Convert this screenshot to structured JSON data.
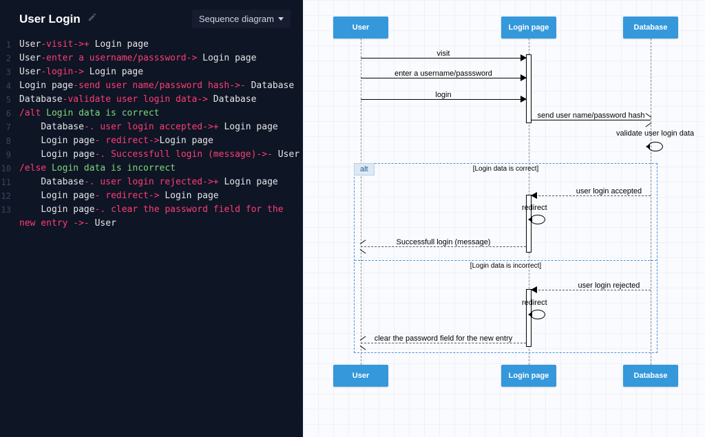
{
  "header": {
    "title": "User Login",
    "diagram_type_label": "Sequence diagram"
  },
  "code": {
    "lines": [
      {
        "n": 1,
        "tokens": [
          [
            "plain",
            "User"
          ],
          [
            "red",
            "-"
          ],
          [
            "red",
            "visit"
          ],
          [
            "red",
            "->+ "
          ],
          [
            "plain",
            "Login page"
          ]
        ]
      },
      {
        "n": 2,
        "tokens": [
          [
            "plain",
            "User"
          ],
          [
            "red",
            "-"
          ],
          [
            "red",
            "enter a username/passsword"
          ],
          [
            "red",
            "-> "
          ],
          [
            "plain",
            "Login page"
          ]
        ]
      },
      {
        "n": 3,
        "tokens": [
          [
            "plain",
            "User"
          ],
          [
            "red",
            "-"
          ],
          [
            "red",
            "login"
          ],
          [
            "red",
            "-> "
          ],
          [
            "plain",
            "Login page"
          ]
        ]
      },
      {
        "n": 4,
        "tokens": [
          [
            "plain",
            "Login page"
          ],
          [
            "red",
            "-"
          ],
          [
            "red",
            "send user name/password hash"
          ],
          [
            "red",
            "->- "
          ],
          [
            "plain",
            "Database"
          ]
        ]
      },
      {
        "n": 5,
        "tokens": [
          [
            "plain",
            "Database"
          ],
          [
            "red",
            "-"
          ],
          [
            "red",
            "validate user login data"
          ],
          [
            "red",
            "-> "
          ],
          [
            "plain",
            "Database"
          ]
        ]
      },
      {
        "n": 6,
        "tokens": [
          [
            "red",
            "/alt "
          ],
          [
            "green",
            "Login data is correct"
          ]
        ]
      },
      {
        "n": 7,
        "tokens": [
          [
            "plain",
            "    Database"
          ],
          [
            "red",
            "-. "
          ],
          [
            "red",
            "user login accepted"
          ],
          [
            "red",
            "->+ "
          ],
          [
            "plain",
            "Login page"
          ]
        ]
      },
      {
        "n": 8,
        "tokens": [
          [
            "plain",
            "    Login page"
          ],
          [
            "red",
            "- "
          ],
          [
            "red",
            "redirect"
          ],
          [
            "red",
            "->"
          ],
          [
            "plain",
            "Login page"
          ]
        ]
      },
      {
        "n": 9,
        "tokens": [
          [
            "plain",
            "    Login page"
          ],
          [
            "red",
            "-. "
          ],
          [
            "red",
            "Successfull login (message)"
          ],
          [
            "red",
            "->- "
          ],
          [
            "plain",
            "User"
          ]
        ]
      },
      {
        "n": 10,
        "tokens": [
          [
            "red",
            "/else "
          ],
          [
            "green",
            "Login data is incorrect"
          ]
        ]
      },
      {
        "n": 11,
        "tokens": [
          [
            "plain",
            "    Database"
          ],
          [
            "red",
            "-. "
          ],
          [
            "red",
            "user login rejected"
          ],
          [
            "red",
            "->+ "
          ],
          [
            "plain",
            "Login page"
          ]
        ]
      },
      {
        "n": 12,
        "tokens": [
          [
            "plain",
            "    Login page"
          ],
          [
            "red",
            "- "
          ],
          [
            "red",
            "redirect"
          ],
          [
            "red",
            "-> "
          ],
          [
            "plain",
            "Login page"
          ]
        ]
      },
      {
        "n": 13,
        "tokens": [
          [
            "plain",
            "    Login page"
          ],
          [
            "red",
            "-. "
          ],
          [
            "red",
            "clear the password field for the new entry "
          ],
          [
            "red",
            "->- "
          ],
          [
            "plain",
            "User"
          ]
        ]
      }
    ]
  },
  "actors": [
    "User",
    "Login page",
    "Database"
  ],
  "messages": {
    "m1": "visit",
    "m2": "enter a username/passsword",
    "m3": "login",
    "m4": "send user name/password hash",
    "m5": "validate user login data",
    "m6": "user login accepted",
    "m7": "redirect",
    "m8": "Successfull login (message)",
    "m9": "user login rejected",
    "m10": "redirect",
    "m11": "clear the password field for the new entry"
  },
  "alt": {
    "tag": "alt",
    "cond_if": "[Login data is correct]",
    "cond_else": "[Login data is incorrect]"
  }
}
